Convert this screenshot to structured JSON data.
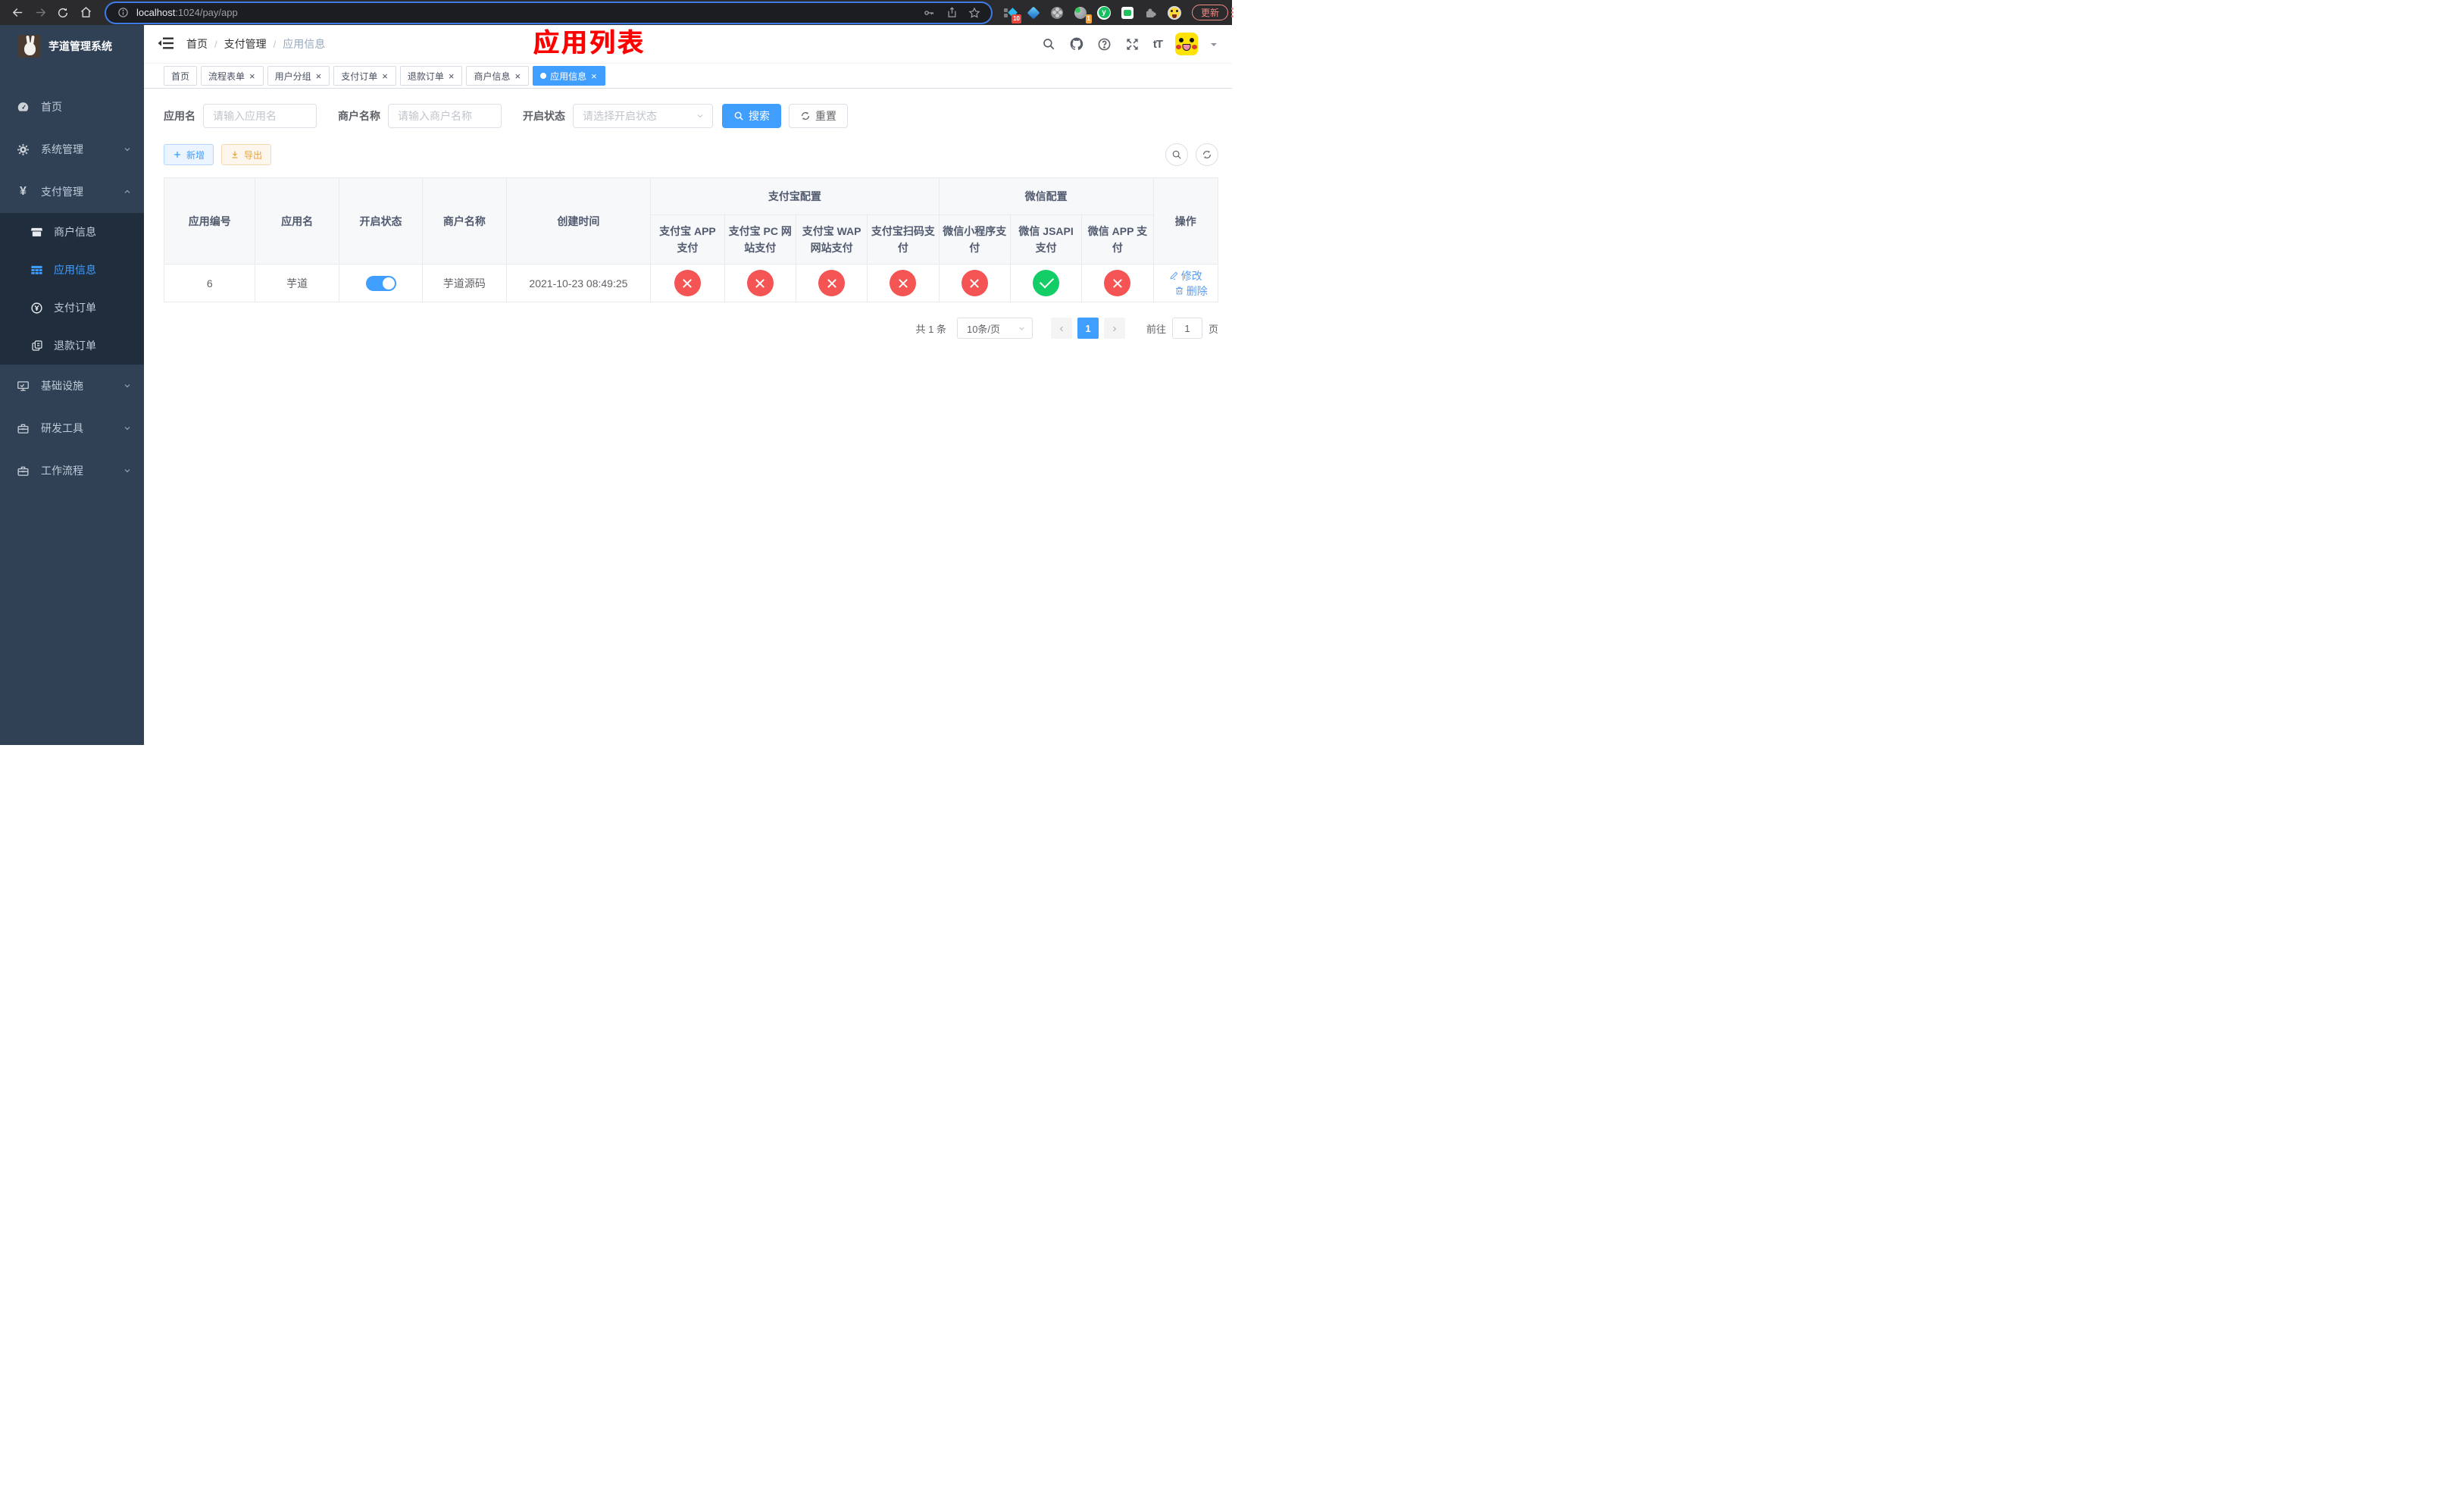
{
  "browser": {
    "url_host": "localhost",
    "url_rest": ":1024/pay/app",
    "update_label": "更新",
    "ext_badge_blue": "10",
    "ext_badge_orange": "1"
  },
  "sidebar": {
    "title": "芋道管理系统",
    "items": [
      {
        "label": "首页"
      },
      {
        "label": "系统管理"
      },
      {
        "label": "支付管理"
      },
      {
        "label": "基础设施"
      },
      {
        "label": "研发工具"
      },
      {
        "label": "工作流程"
      }
    ],
    "submenu": [
      {
        "label": "商户信息"
      },
      {
        "label": "应用信息"
      },
      {
        "label": "支付订单"
      },
      {
        "label": "退款订单"
      }
    ]
  },
  "header": {
    "breadcrumb": [
      "首页",
      "支付管理",
      "应用信息"
    ],
    "annotation": "应用列表",
    "font_icon_label": "tT"
  },
  "tabs": [
    {
      "label": "首页"
    },
    {
      "label": "流程表单"
    },
    {
      "label": "用户分组"
    },
    {
      "label": "支付订单"
    },
    {
      "label": "退款订单"
    },
    {
      "label": "商户信息"
    },
    {
      "label": "应用信息"
    }
  ],
  "filters": {
    "app_name_label": "应用名",
    "app_name_placeholder": "请输入应用名",
    "merchant_label": "商户名称",
    "merchant_placeholder": "请输入商户名称",
    "status_label": "开启状态",
    "status_placeholder": "请选择开启状态",
    "search_label": "搜索",
    "reset_label": "重置"
  },
  "toolbar": {
    "add_label": "新增",
    "export_label": "导出"
  },
  "table": {
    "col_app_id": "应用编号",
    "col_app_name": "应用名",
    "col_status": "开启状态",
    "col_merchant": "商户名称",
    "col_created": "创建时间",
    "group_alipay": "支付宝配置",
    "group_wechat": "微信配置",
    "sub_alipay_app": "支付宝 APP 支付",
    "sub_alipay_pc": "支付宝 PC 网站支付",
    "sub_alipay_wap": "支付宝 WAP 网站支付",
    "sub_alipay_qr": "支付宝扫码支付",
    "sub_wx_mini": "微信小程序支付",
    "sub_wx_jsapi": "微信 JSAPI 支付",
    "sub_wx_app": "微信 APP 支付",
    "col_actions": "操作",
    "row": {
      "app_id": "6",
      "app_name": "芋道",
      "merchant": "芋道源码",
      "created": "2021-10-23 08:49:25",
      "statuses": [
        "x",
        "x",
        "x",
        "x",
        "x",
        "check",
        "x"
      ],
      "edit_label": "修改",
      "delete_label": "删除"
    }
  },
  "pagination": {
    "total_label": "共 1 条",
    "page_size_label": "10条/页",
    "prev_glyph": "‹",
    "next_glyph": "›",
    "current_page": "1",
    "goto_label": "前往",
    "goto_value": "1",
    "page_unit_label": "页"
  },
  "ui": {
    "close_glyph": "×",
    "breadcrumb_separator": "/",
    "yen": "¥"
  },
  "colors": {
    "accent": "#409EFF",
    "success": "#13ce66",
    "danger": "#f45454",
    "warning": "#e6a23c",
    "annotation_red": "#ff0000",
    "sidebar_bg": "#304156",
    "submenu_bg": "#1f2d3d"
  }
}
